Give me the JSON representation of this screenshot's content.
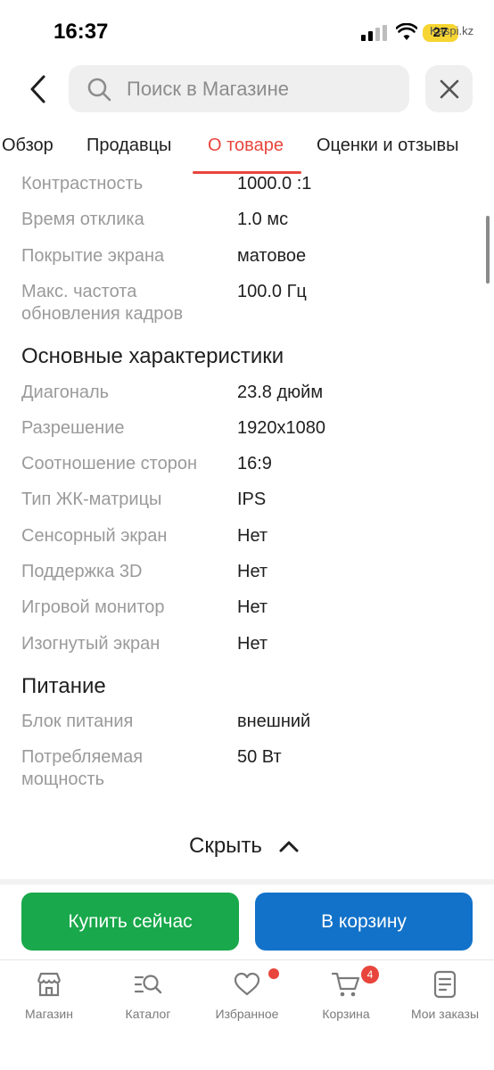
{
  "status_bar": {
    "time": "16:37",
    "battery": "27",
    "watermark": "Kaspi.kz"
  },
  "search": {
    "placeholder": "Поиск в Магазине"
  },
  "tabs": [
    {
      "label": "Обзор"
    },
    {
      "label": "Продавцы"
    },
    {
      "label": "О товаре",
      "active": true
    },
    {
      "label": "Оценки и отзывы"
    }
  ],
  "specs_top": [
    {
      "label": "Контрастность",
      "value": "1000.0 :1"
    },
    {
      "label": "Время отклика",
      "value": "1.0 мс"
    },
    {
      "label": "Покрытие экрана",
      "value": "матовое"
    },
    {
      "label": "Макс. частота обновления кадров",
      "value": "100.0 Гц"
    }
  ],
  "main_section": {
    "title": "Основные характеристики",
    "rows": [
      {
        "label": "Диагональ",
        "value": "23.8 дюйм"
      },
      {
        "label": "Разрешение",
        "value": "1920x1080"
      },
      {
        "label": "Соотношение сторон",
        "value": "16:9"
      },
      {
        "label": "Тип ЖК-матрицы",
        "value": "IPS"
      },
      {
        "label": "Сенсорный экран",
        "value": "Нет"
      },
      {
        "label": "Поддержка 3D",
        "value": "Нет"
      },
      {
        "label": "Игровой монитор",
        "value": "Нет"
      },
      {
        "label": "Изогнутый экран",
        "value": "Нет"
      }
    ]
  },
  "power_section": {
    "title": "Питание",
    "rows": [
      {
        "label": "Блок питания",
        "value": "внешний"
      },
      {
        "label": "Потребляемая мощность",
        "value": "50 Вт"
      }
    ]
  },
  "collapse": {
    "label": "Скрыть"
  },
  "actions": {
    "buy_now": "Купить сейчас",
    "add_to_cart": "В корзину"
  },
  "nav": {
    "items": [
      {
        "label": "Магазин",
        "icon": "store-icon"
      },
      {
        "label": "Каталог",
        "icon": "catalog-search-icon"
      },
      {
        "label": "Избранное",
        "icon": "heart-icon"
      },
      {
        "label": "Корзина",
        "icon": "cart-icon"
      },
      {
        "label": "Мои заказы",
        "icon": "orders-icon"
      }
    ],
    "cart_count": "4"
  },
  "colors": {
    "accent_red": "#e8453c",
    "buy_green": "#19a84b",
    "cart_blue": "#1272c9"
  }
}
